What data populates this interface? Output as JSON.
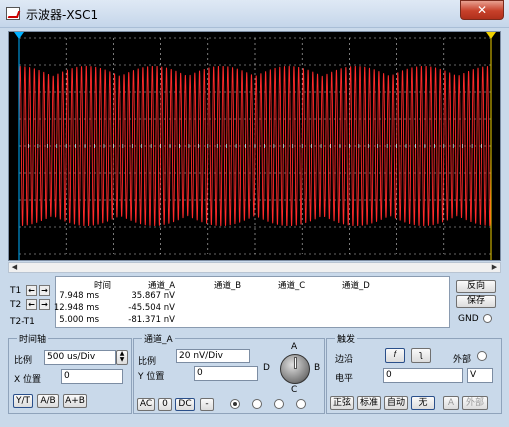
{
  "window": {
    "title": "示波器-XSC1",
    "close_label": "✕"
  },
  "readout": {
    "row_labels": [
      "T1",
      "T2",
      "T2-T1"
    ],
    "headers": {
      "time": "时间",
      "ch_a": "通道_A",
      "ch_b": "通道_B",
      "ch_c": "通道_C",
      "ch_d": "通道_D"
    },
    "rows": [
      {
        "time": "7.948 ms",
        "ch_a": "35.867 nV"
      },
      {
        "time": "12.948 ms",
        "ch_a": "-45.504 nV"
      },
      {
        "time": "5.000 ms",
        "ch_a": "-81.371 nV"
      }
    ],
    "reverse_label": "反向",
    "save_label": "保存",
    "gnd_label": "GND"
  },
  "timebase": {
    "title": "时间轴",
    "scale_label": "比例",
    "scale_value": "500 us/Div",
    "xpos_label": "X 位置",
    "xpos_value": "0",
    "modes": [
      "Y/T",
      "A/B",
      "A+B"
    ]
  },
  "channel_a": {
    "title": "通道_A",
    "scale_label": "比例",
    "scale_value": "20 nV/Div",
    "ypos_label": "Y 位置",
    "ypos_value": "0",
    "coupling": [
      "AC",
      "0",
      "DC",
      "-"
    ],
    "knob_labels": {
      "a": "A",
      "b": "B",
      "c": "C",
      "d": "D"
    }
  },
  "trigger": {
    "title": "触发",
    "edge_label": "边沿",
    "edge_rising": "𝑓",
    "edge_falling": "ʅ",
    "external_label": "外部",
    "level_label": "电平",
    "level_value": "0",
    "level_unit": "V",
    "modes": [
      "正弦",
      "标准",
      "自动",
      "无"
    ],
    "a_label": "A",
    "ext_label": "外部"
  },
  "colors": {
    "trace": "#ff2a2a",
    "screen": "#000000",
    "grid": "#ffffff",
    "cursor1": "#00b0ff",
    "cursor2": "#f0d000"
  }
}
